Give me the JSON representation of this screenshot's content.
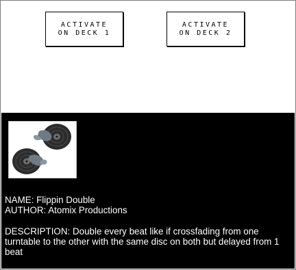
{
  "deck_buttons": [
    {
      "line1": "ACTIVATE",
      "line2": "ON DECK 1"
    },
    {
      "line1": "ACTIVATE",
      "line2": "ON DECK 2"
    }
  ],
  "effect": {
    "thumbnail_icon": "double-turntable-icon",
    "name_label": "NAME: Flippin Double",
    "author_label": "AUTHOR: Atomix Productions",
    "description_label": "DESCRIPTION: Double every beat like if crossfading from one turntable to the other with the same disc on both but delayed from 1 beat"
  },
  "colors": {
    "info_background": "#000000",
    "info_text": "#ffffff",
    "button_border": "#000000"
  }
}
